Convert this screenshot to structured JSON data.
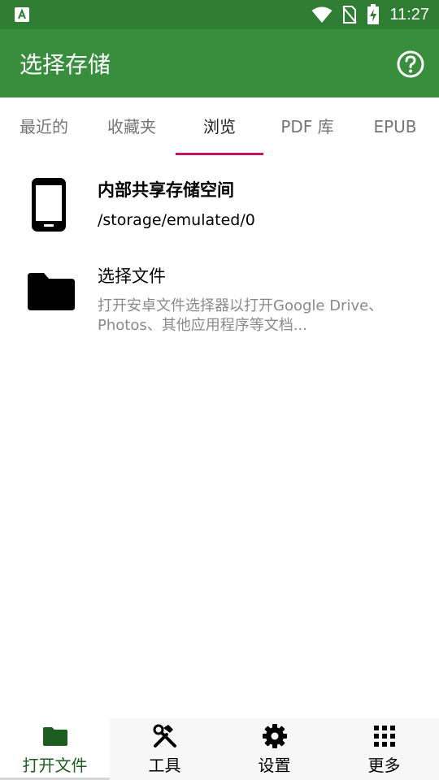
{
  "status_bar": {
    "time": "11:27",
    "left_icon": "app-notification-icon",
    "icons": [
      "wifi-icon",
      "no-sim-icon",
      "battery-charging-icon"
    ]
  },
  "app_bar": {
    "title": "选择存储",
    "help_icon": "help-icon"
  },
  "tabs": [
    {
      "label": "最近的",
      "active": false
    },
    {
      "label": "收藏夹",
      "active": false
    },
    {
      "label": "浏览",
      "active": true
    },
    {
      "label": "PDF 库",
      "active": false
    },
    {
      "label": "EPUB",
      "active": false
    }
  ],
  "list": {
    "items": [
      {
        "icon": "phone-icon",
        "title": "内部共享存储空间",
        "subtitle": "/storage/emulated/0"
      },
      {
        "icon": "folder-icon",
        "title": "选择文件",
        "description": "打开安卓文件选择器以打开Google Drive、Photos、其他应用程序等文档..."
      }
    ]
  },
  "bottom_nav": [
    {
      "label": "打开文件",
      "icon": "folder-icon",
      "active": true
    },
    {
      "label": "工具",
      "icon": "tools-icon",
      "active": false
    },
    {
      "label": "设置",
      "icon": "gear-icon",
      "active": false
    },
    {
      "label": "更多",
      "icon": "grid-icon",
      "active": false
    }
  ],
  "colors": {
    "status_bar": "#2e7d32",
    "app_bar": "#388e3c",
    "tab_indicator": "#c2185b",
    "active_nav": "#1b5e20"
  }
}
